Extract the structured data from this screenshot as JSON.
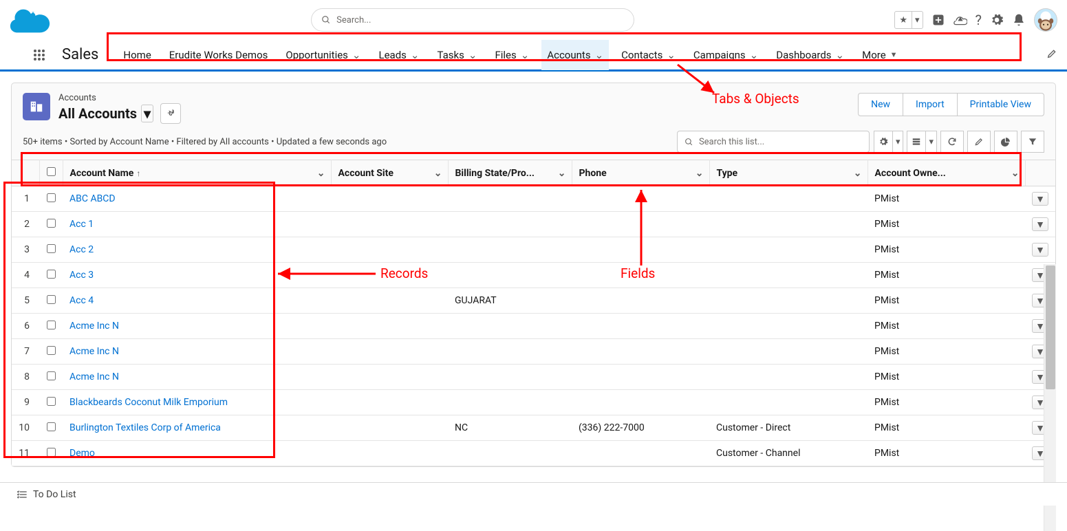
{
  "search_placeholder": "Search...",
  "app_name": "Sales",
  "nav": {
    "items": [
      {
        "label": "Home",
        "dropdown": false
      },
      {
        "label": "Erudite Works Demos",
        "dropdown": false
      },
      {
        "label": "Opportunities",
        "dropdown": true
      },
      {
        "label": "Leads",
        "dropdown": true
      },
      {
        "label": "Tasks",
        "dropdown": true
      },
      {
        "label": "Files",
        "dropdown": true
      },
      {
        "label": "Accounts",
        "dropdown": true,
        "active": true
      },
      {
        "label": "Contacts",
        "dropdown": true
      },
      {
        "label": "Campaigns",
        "dropdown": true
      },
      {
        "label": "Dashboards",
        "dropdown": true
      },
      {
        "label": "More",
        "dropdown": true,
        "filled": true
      }
    ]
  },
  "object_label": "Accounts",
  "list_name": "All Accounts",
  "action_buttons": {
    "new": "New",
    "import": "Import",
    "printable": "Printable View"
  },
  "list_meta": "50+ items • Sorted by Account Name • Filtered by All accounts • Updated a few seconds ago",
  "list_search_placeholder": "Search this list...",
  "columns": {
    "c0": "",
    "c1": "",
    "name": "Account Name",
    "site": "Account Site",
    "state": "Billing State/Pro...",
    "phone": "Phone",
    "type": "Type",
    "owner": "Account Owne..."
  },
  "rows": [
    {
      "n": "1",
      "name": "ABC ABCD",
      "site": "",
      "state": "",
      "phone": "",
      "type": "",
      "owner": "PMist"
    },
    {
      "n": "2",
      "name": "Acc 1",
      "site": "",
      "state": "",
      "phone": "",
      "type": "",
      "owner": "PMist"
    },
    {
      "n": "3",
      "name": "Acc 2",
      "site": "",
      "state": "",
      "phone": "",
      "type": "",
      "owner": "PMist"
    },
    {
      "n": "4",
      "name": "Acc 3",
      "site": "",
      "state": "",
      "phone": "",
      "type": "",
      "owner": "PMist"
    },
    {
      "n": "5",
      "name": "Acc 4",
      "site": "",
      "state": "GUJARAT",
      "phone": "",
      "type": "",
      "owner": "PMist"
    },
    {
      "n": "6",
      "name": "Acme Inc N",
      "site": "",
      "state": "",
      "phone": "",
      "type": "",
      "owner": "PMist"
    },
    {
      "n": "7",
      "name": "Acme Inc N",
      "site": "",
      "state": "",
      "phone": "",
      "type": "",
      "owner": "PMist"
    },
    {
      "n": "8",
      "name": "Acme Inc N",
      "site": "",
      "state": "",
      "phone": "",
      "type": "",
      "owner": "PMist"
    },
    {
      "n": "9",
      "name": "Blackbeards Coconut Milk Emporium",
      "site": "",
      "state": "",
      "phone": "",
      "type": "",
      "owner": "PMist"
    },
    {
      "n": "10",
      "name": "Burlington Textiles Corp of America",
      "site": "",
      "state": "NC",
      "phone": "(336) 222-7000",
      "type": "Customer - Direct",
      "owner": "PMist"
    },
    {
      "n": "11",
      "name": "Demo",
      "site": "",
      "state": "",
      "phone": "",
      "type": "Customer - Channel",
      "owner": "PMist"
    }
  ],
  "annotations": {
    "tabs": "Tabs & Objects",
    "records": "Records",
    "fields": "Fields"
  },
  "footer": "To Do List"
}
